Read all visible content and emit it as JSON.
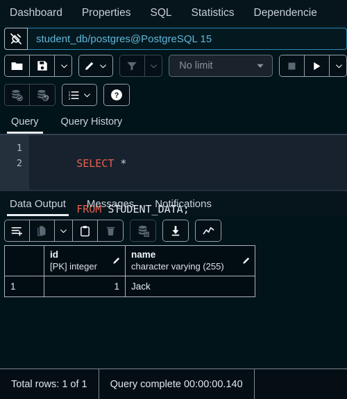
{
  "object_tabs": [
    {
      "label": "Dashboard"
    },
    {
      "label": "Properties"
    },
    {
      "label": "SQL"
    },
    {
      "label": "Statistics"
    },
    {
      "label": "Dependencie"
    }
  ],
  "connection": {
    "icon": "connection-plug-icon",
    "value": "student_db/postgres@PostgreSQL 15"
  },
  "toolbar_primary": {
    "open_file": {
      "icon": "folder-open-icon",
      "label": "Open File"
    },
    "save_file": {
      "icon": "save-floppy-icon",
      "label": "Save"
    },
    "save_dropdown": {
      "icon": "chevron-down-icon"
    },
    "edit": {
      "icon": "pencil-edit-icon",
      "label": "Edit"
    },
    "edit_dropdown": {
      "icon": "chevron-down-icon"
    },
    "filter": {
      "icon": "funnel-filter-icon",
      "label": "Filter",
      "disabled": true
    },
    "filter_dropdown": {
      "icon": "chevron-down-icon",
      "disabled": true
    },
    "row_limit": {
      "value": "No limit",
      "icon": "chevron-down-icon"
    },
    "stop": {
      "icon": "stop-square-icon",
      "label": "Stop",
      "disabled": true
    },
    "execute": {
      "icon": "play-triangle-icon",
      "label": "Execute"
    },
    "execute_dropdown": {
      "icon": "chevron-down-icon"
    }
  },
  "toolbar_secondary": {
    "commit": {
      "icon": "database-check-icon",
      "label": "Commit",
      "disabled": true
    },
    "rollback": {
      "icon": "database-undo-icon",
      "label": "Rollback",
      "disabled": true
    },
    "explain_options": {
      "icon": "numbered-list-icon",
      "dropdown_icon": "chevron-down-icon"
    },
    "help": {
      "icon": "question-circle-icon",
      "label": "Help"
    }
  },
  "query_tabs": {
    "items": [
      {
        "label": "Query",
        "active": true
      },
      {
        "label": "Query History",
        "active": false
      }
    ]
  },
  "editor": {
    "lines": [
      {
        "number": "1",
        "keyword": "SELECT",
        "rest": " *"
      },
      {
        "number": "2",
        "keyword": "FROM",
        "rest": " STUDENT_DATA;"
      }
    ]
  },
  "output_tabs": {
    "items": [
      {
        "label": "Data Output",
        "active": true
      },
      {
        "label": "Messages",
        "active": false
      },
      {
        "label": "Notifications",
        "active": false
      }
    ]
  },
  "results_toolbar": {
    "add_row": {
      "icon": "add-row-icon",
      "label": "Add row"
    },
    "copy": {
      "icon": "copy-icon",
      "label": "Copy",
      "disabled": true
    },
    "copy_dropdown": {
      "icon": "chevron-down-icon"
    },
    "paste": {
      "icon": "paste-clipboard-icon",
      "label": "Paste"
    },
    "delete": {
      "icon": "trash-delete-icon",
      "label": "Delete",
      "disabled": true
    },
    "save_data": {
      "icon": "database-save-icon",
      "label": "Save Data Changes",
      "disabled": true
    },
    "download": {
      "icon": "download-arrow-icon",
      "label": "Download as CSV"
    },
    "graph": {
      "icon": "line-graph-icon",
      "label": "Graph Visualiser"
    }
  },
  "results_grid": {
    "row_number_header": "",
    "columns": [
      {
        "name": "id",
        "type": "[PK] integer",
        "edit_icon": "pencil-icon"
      },
      {
        "name": "name",
        "type": "character varying (255)",
        "edit_icon": "pencil-icon"
      }
    ],
    "rows": [
      {
        "num": "1",
        "id": "1",
        "name": "Jack"
      }
    ]
  },
  "status_bar": {
    "total_rows": "Total rows: 1 of 1",
    "query_status": "Query complete 00:00:00.140"
  }
}
